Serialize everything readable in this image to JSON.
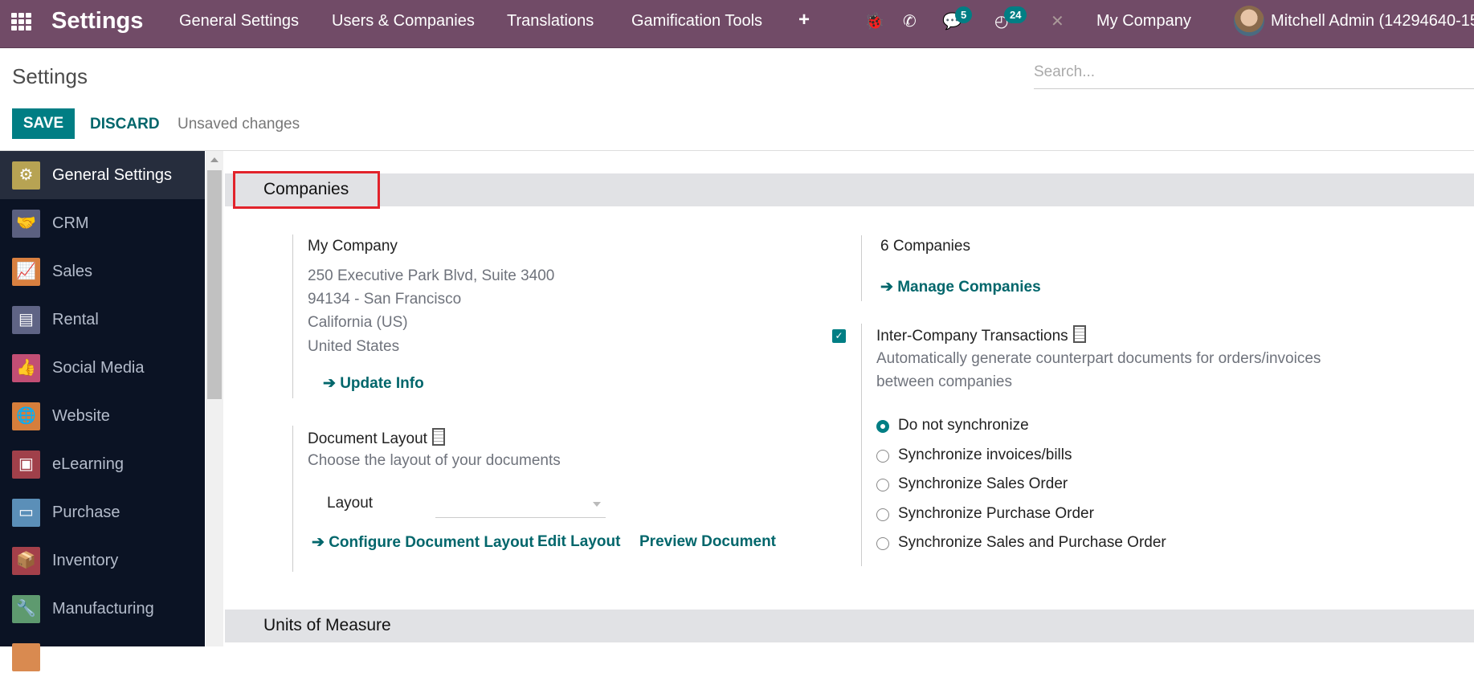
{
  "navbar": {
    "app_title": "Settings",
    "menus": [
      "General Settings",
      "Users & Companies",
      "Translations",
      "Gamification Tools"
    ],
    "messages_badge": "5",
    "activities_badge": "24",
    "company": "My Company",
    "user": "Mitchell Admin (14294640-15"
  },
  "control_panel": {
    "title": "Settings",
    "search_placeholder": "Search...",
    "save_label": "SAVE",
    "discard_label": "DISCARD",
    "status": "Unsaved changes"
  },
  "sidebar": {
    "items": [
      {
        "label": "General Settings",
        "icon": "gear-icon",
        "color": "#b7a353",
        "glyph": "⚙",
        "active": true
      },
      {
        "label": "CRM",
        "icon": "handshake-icon",
        "color": "#5b6080",
        "glyph": "🤝"
      },
      {
        "label": "Sales",
        "icon": "chart-up-icon",
        "color": "#d98040",
        "glyph": "📈"
      },
      {
        "label": "Rental",
        "icon": "rental-icon",
        "color": "#5f6485",
        "glyph": "▤"
      },
      {
        "label": "Social Media",
        "icon": "thumbs-up-icon",
        "color": "#c24e74",
        "glyph": "👍"
      },
      {
        "label": "Website",
        "icon": "globe-icon",
        "color": "#d67e3b",
        "glyph": "🌐"
      },
      {
        "label": "eLearning",
        "icon": "elearning-icon",
        "color": "#a0404a",
        "glyph": "▣"
      },
      {
        "label": "Purchase",
        "icon": "credit-card-icon",
        "color": "#5b8fb8",
        "glyph": "▭"
      },
      {
        "label": "Inventory",
        "icon": "box-icon",
        "color": "#a4404a",
        "glyph": "📦"
      },
      {
        "label": "Manufacturing",
        "icon": "wrench-icon",
        "color": "#5e9a6f",
        "glyph": "🔧"
      },
      {
        "label": "",
        "icon": "app-icon",
        "color": "#d98a50",
        "glyph": ""
      }
    ]
  },
  "sections": {
    "companies": {
      "title": "Companies",
      "company_name": "My Company",
      "address": [
        "250 Executive Park Blvd, Suite 3400",
        "94134 - San Francisco",
        "California (US)",
        "United States"
      ],
      "update_info": "Update Info",
      "companies_count": "6",
      "companies_label": "Companies",
      "manage_companies": "Manage Companies",
      "doc_layout_title": "Document Layout",
      "doc_layout_desc": "Choose the layout of your documents",
      "layout_label": "Layout",
      "layout_value": "",
      "configure_layout": "Configure Document Layout",
      "edit_layout": "Edit Layout",
      "preview_document": "Preview Document",
      "inter_company_title": "Inter-Company Transactions",
      "inter_company_checked": true,
      "inter_company_desc_1": "Automatically generate counterpart documents for orders/invoices",
      "inter_company_desc_2": "between companies",
      "sync_options": [
        {
          "label": "Do not synchronize",
          "selected": true
        },
        {
          "label": "Synchronize invoices/bills",
          "selected": false
        },
        {
          "label": "Synchronize Sales Order",
          "selected": false
        },
        {
          "label": "Synchronize Purchase Order",
          "selected": false
        },
        {
          "label": "Synchronize Sales and Purchase Order",
          "selected": false
        }
      ]
    },
    "units": {
      "title": "Units of Measure"
    }
  }
}
